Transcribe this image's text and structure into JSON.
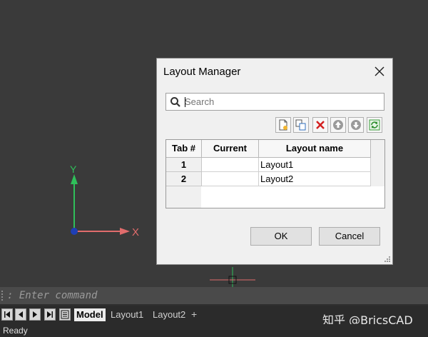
{
  "dialog": {
    "title": "Layout Manager",
    "search_placeholder": "Search",
    "toolbar": [
      "new-layout",
      "copy-layout",
      "delete-layout",
      "move-up",
      "move-down",
      "refresh"
    ],
    "columns": [
      "Tab #",
      "Current",
      "Layout name"
    ],
    "rows": [
      {
        "tab": "1",
        "current": "",
        "name": "Layout1"
      },
      {
        "tab": "2",
        "current": "",
        "name": "Layout2"
      }
    ],
    "ok_label": "OK",
    "cancel_label": "Cancel"
  },
  "viewport": {
    "axis_x_label": "X",
    "axis_y_label": "Y",
    "axis_x_color": "#e06c6c",
    "axis_y_color": "#2fbf5a"
  },
  "command": {
    "prompt": ": Enter command"
  },
  "layout_tabs": [
    "Model",
    "Layout1",
    "Layout2"
  ],
  "active_tab": "Model",
  "add_tab_label": "+",
  "watermark": "知乎 @BricsCAD",
  "status": {
    "text": "Ready"
  }
}
